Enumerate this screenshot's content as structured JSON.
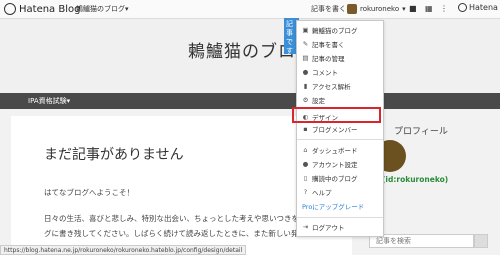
{
  "topbar": {
    "brand": "Hatena Blog",
    "blog_selector": "鶫鱸猫のブログ▾",
    "write_label": "記事を書く",
    "username": "rokuroneko",
    "hatena_label": "Hatena"
  },
  "header": {
    "blog_title": "鶫鱸猫のブロ"
  },
  "nav": {
    "item": "IPA資格試験▾"
  },
  "tooltip": "記事です",
  "main": {
    "heading": "まだ記事がありません",
    "paragraph1": "はてなブログへようこそ！",
    "paragraph2": "日々の生活、喜びと悲しみ、特別な出会い、ちょっとした考えや思いつきを、",
    "paragraph3": "グに書き残してください。しばらく続けて読み返したときに、また新しい発見"
  },
  "sidebar": {
    "profile_title": "プロフィール",
    "user_id": "(id:rokuroneko)",
    "search_placeholder": "記事を検索"
  },
  "status_url": "https://blog.hatena.ne.jp/rokuroneko/rokuroneko.hateblo.jp/config/design/detail",
  "menu": {
    "items": [
      {
        "icon": "blog-icon",
        "label": "鶫鱸猫のブログ"
      },
      {
        "icon": "edit-icon",
        "label": "記事を書く"
      },
      {
        "icon": "list-icon",
        "label": "記事の管理"
      },
      {
        "icon": "comment-icon",
        "label": "コメント"
      },
      {
        "icon": "analytics-icon",
        "label": "アクセス解析"
      },
      {
        "icon": "settings-icon",
        "label": "設定"
      },
      {
        "icon": "design-icon",
        "label": "デザイン"
      },
      {
        "icon": "members-icon",
        "label": "ブログメンバー"
      },
      {
        "icon": "dashboard-icon",
        "label": "ダッシュボード"
      },
      {
        "icon": "account-icon",
        "label": "アカウント設定"
      },
      {
        "icon": "reading-icon",
        "label": "購読中のブログ"
      },
      {
        "icon": "help-icon",
        "label": "ヘルプ"
      },
      {
        "icon": "",
        "label": "Proにアップグレード"
      },
      {
        "icon": "logout-icon",
        "label": "ログアウト"
      }
    ]
  },
  "colors": {
    "highlight": "#d8262c",
    "pro_link": "#2a7ed6",
    "nav_bg": "#4a4a4a",
    "tooltip_bg": "#3b8fd8"
  }
}
